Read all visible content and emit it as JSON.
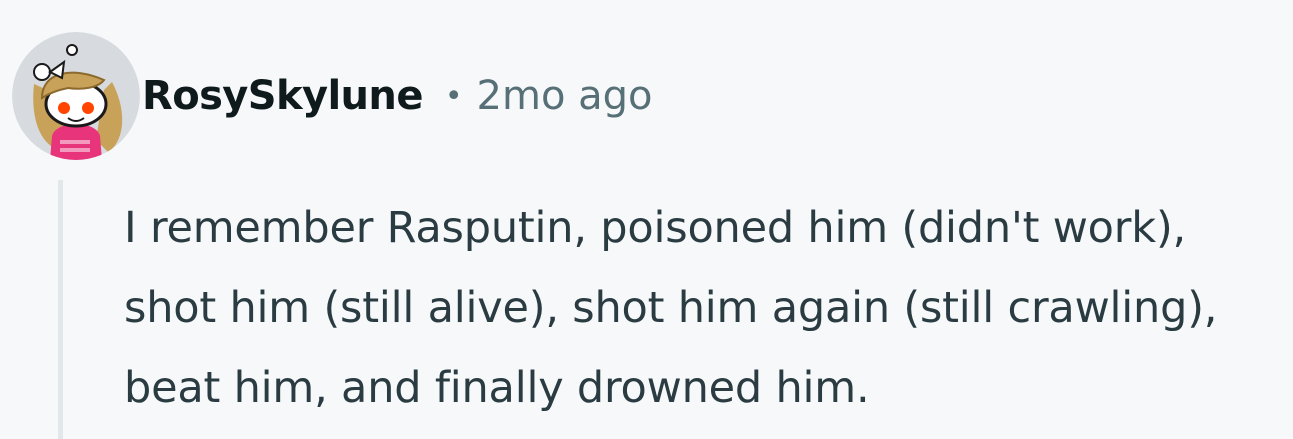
{
  "comment": {
    "author": "RosySkylune",
    "separator": "•",
    "timestamp": "2mo ago",
    "avatar_icon": "reddit-snoo-avatar-icon",
    "body": "I remember Rasputin, poisoned him (didn't work), shot him (still alive), shot him again (still crawling), beat him, and finally drowned him."
  },
  "colors": {
    "background": "#f6f8fa",
    "author": "#0f1a1c",
    "meta": "#576f76",
    "body_text": "#2a3c42",
    "thread_line": "#e2e7ea",
    "avatar_bg": "#d7dbdf",
    "avatar_hair": "#c9a25a",
    "avatar_shirt": "#e7347a"
  }
}
